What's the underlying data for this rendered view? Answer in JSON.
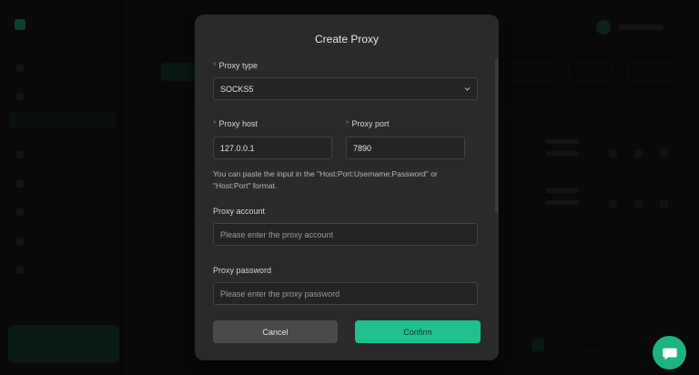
{
  "modal": {
    "title": "Create Proxy",
    "proxy_type": {
      "label": "Proxy type",
      "value": "SOCKS5"
    },
    "proxy_host": {
      "label": "Proxy host",
      "value": "127.0.0.1"
    },
    "proxy_port": {
      "label": "Proxy port",
      "value": "7890"
    },
    "hint": "You can paste the input in the \"Host:Port:Username:Password\" or \"Host:Port\" format.",
    "proxy_account": {
      "label": "Proxy account",
      "placeholder": "Please enter the proxy account"
    },
    "proxy_password": {
      "label": "Proxy password",
      "placeholder": "Please enter the proxy password"
    },
    "cancel_label": "Cancel",
    "confirm_label": "Confirm",
    "required_mark": "*"
  },
  "colors": {
    "accent": "#21c08f",
    "required": "#e04848",
    "modal_bg": "#2a2a2a"
  },
  "icons": {
    "select_chevron": "chevron-down-icon",
    "chat": "chat-bubble-icon"
  }
}
